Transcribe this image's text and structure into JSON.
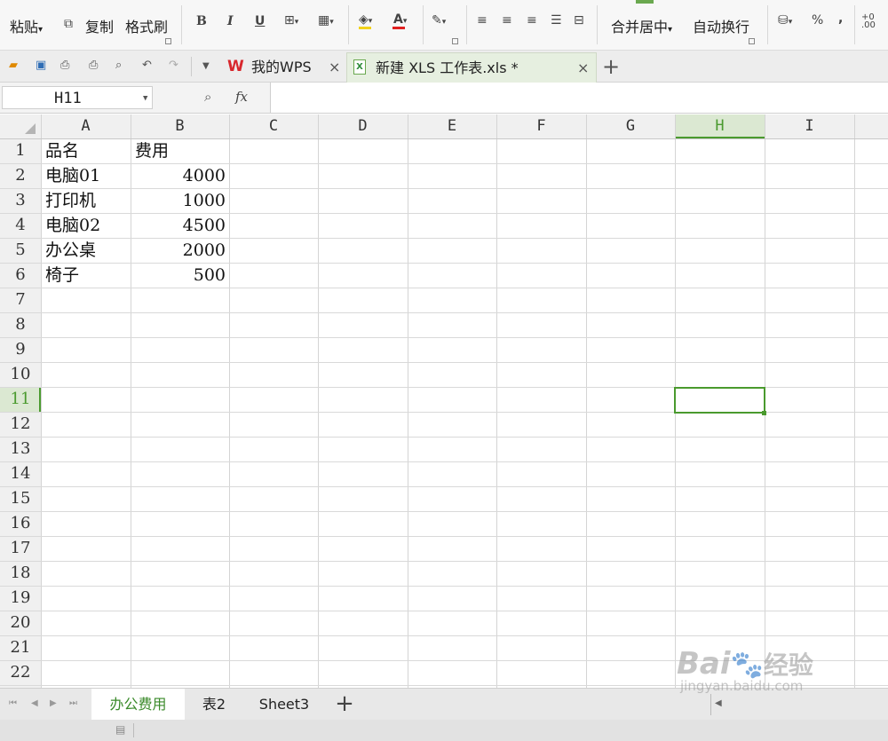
{
  "ribbon": {
    "paste_label": "粘贴",
    "copy_label": "复制",
    "format_painter_label": "格式刷",
    "bold_glyph": "B",
    "italic_glyph": "I",
    "underline_glyph": "U",
    "font_color_glyph": "A",
    "merge_center_label": "合并居中",
    "wrap_text_label": "自动换行",
    "percent_glyph": "%",
    "comma_glyph": ","
  },
  "tabs": [
    {
      "label": "我的WPS",
      "icon": "wps-logo-icon"
    },
    {
      "label": "新建 XLS 工作表.xls *",
      "icon": "xls-file-icon",
      "active": true
    }
  ],
  "formula_bar": {
    "cell_ref": "H11",
    "fx_label": "fx",
    "content": ""
  },
  "grid": {
    "columns": [
      "A",
      "B",
      "C",
      "D",
      "E",
      "F",
      "G",
      "H",
      "I"
    ],
    "rows": [
      "1",
      "2",
      "3",
      "4",
      "5",
      "6",
      "7",
      "8",
      "9",
      "10",
      "11",
      "12",
      "13",
      "14",
      "15",
      "16",
      "17",
      "18",
      "19",
      "20",
      "21",
      "22"
    ],
    "selected_column": "H",
    "selected_row": "11",
    "selected_cell": "H11",
    "cells": [
      {
        "ref": "A1",
        "value": "品名"
      },
      {
        "ref": "B1",
        "value": "费用"
      },
      {
        "ref": "A2",
        "value": "电脑01"
      },
      {
        "ref": "B2",
        "value": "4000",
        "numeric": true
      },
      {
        "ref": "A3",
        "value": "打印机"
      },
      {
        "ref": "B3",
        "value": "1000",
        "numeric": true
      },
      {
        "ref": "A4",
        "value": "电脑02"
      },
      {
        "ref": "B4",
        "value": "4500",
        "numeric": true
      },
      {
        "ref": "A5",
        "value": "办公桌"
      },
      {
        "ref": "B5",
        "value": "2000",
        "numeric": true
      },
      {
        "ref": "A6",
        "value": "椅子"
      },
      {
        "ref": "B6",
        "value": "500",
        "numeric": true
      }
    ]
  },
  "sheets": [
    {
      "label": "办公费用",
      "active": true
    },
    {
      "label": "表2"
    },
    {
      "label": "Sheet3"
    }
  ],
  "add_sheet_glyph": "+",
  "add_tab_glyph": "+",
  "watermark": {
    "brand": "Bai",
    "brand_cn": "经验",
    "url": "jingyan.baidu.com"
  },
  "colors": {
    "selection_green": "#4a9a2e",
    "active_sheet_underline": "#d83b3b",
    "wps_red": "#d8272d",
    "xls_green": "#2e8b3a"
  }
}
